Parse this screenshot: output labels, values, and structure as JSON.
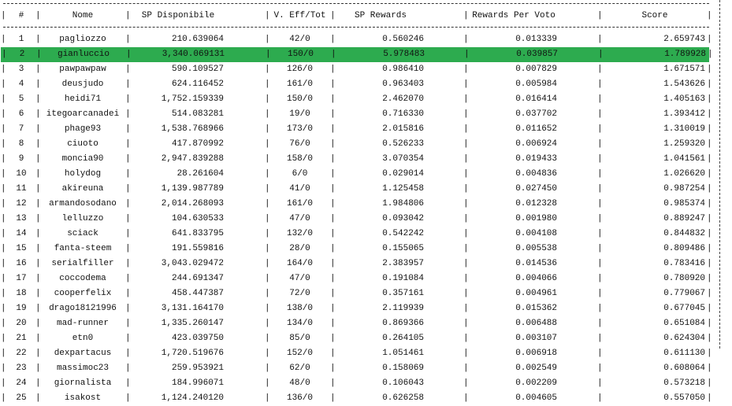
{
  "table": {
    "columns": [
      "#",
      "Nome",
      "SP Disponibile",
      "V. Eff/Tot",
      "SP Rewards",
      "Rewards Per Voto",
      "Score"
    ],
    "separator": "|",
    "highlight_color": "#2dab4f",
    "highlighted_rank": "2",
    "rows": [
      [
        "1",
        "pagliozzo",
        "210.639064",
        "42/0",
        "0.560246",
        "0.013339",
        "2.659743"
      ],
      [
        "2",
        "gianluccio",
        "3,340.069131",
        "150/0",
        "5.978483",
        "0.039857",
        "1.789928"
      ],
      [
        "3",
        "pawpawpaw",
        "590.109527",
        "126/0",
        "0.986410",
        "0.007829",
        "1.671571"
      ],
      [
        "4",
        "deusjudo",
        "624.116452",
        "161/0",
        "0.963403",
        "0.005984",
        "1.543626"
      ],
      [
        "5",
        "heidi71",
        "1,752.159339",
        "150/0",
        "2.462070",
        "0.016414",
        "1.405163"
      ],
      [
        "6",
        "itegoarcanadei",
        "514.083281",
        "19/0",
        "0.716330",
        "0.037702",
        "1.393412"
      ],
      [
        "7",
        "phage93",
        "1,538.768966",
        "173/0",
        "2.015816",
        "0.011652",
        "1.310019"
      ],
      [
        "8",
        "ciuoto",
        "417.870992",
        "76/0",
        "0.526233",
        "0.006924",
        "1.259320"
      ],
      [
        "9",
        "moncia90",
        "2,947.839288",
        "158/0",
        "3.070354",
        "0.019433",
        "1.041561"
      ],
      [
        "10",
        "holydog",
        "28.261604",
        "6/0",
        "0.029014",
        "0.004836",
        "1.026620"
      ],
      [
        "11",
        "akireuna",
        "1,139.987789",
        "41/0",
        "1.125458",
        "0.027450",
        "0.987254"
      ],
      [
        "12",
        "armandosodano",
        "2,014.268093",
        "161/0",
        "1.984806",
        "0.012328",
        "0.985374"
      ],
      [
        "13",
        "lelluzzo",
        "104.630533",
        "47/0",
        "0.093042",
        "0.001980",
        "0.889247"
      ],
      [
        "14",
        "sciack",
        "641.833795",
        "132/0",
        "0.542242",
        "0.004108",
        "0.844832"
      ],
      [
        "15",
        "fanta-steem",
        "191.559816",
        "28/0",
        "0.155065",
        "0.005538",
        "0.809486"
      ],
      [
        "16",
        "serialfiller",
        "3,043.029472",
        "164/0",
        "2.383957",
        "0.014536",
        "0.783416"
      ],
      [
        "17",
        "coccodema",
        "244.691347",
        "47/0",
        "0.191084",
        "0.004066",
        "0.780920"
      ],
      [
        "18",
        "cooperfelix",
        "458.447387",
        "72/0",
        "0.357161",
        "0.004961",
        "0.779067"
      ],
      [
        "19",
        "drago18121996",
        "3,131.164170",
        "138/0",
        "2.119939",
        "0.015362",
        "0.677045"
      ],
      [
        "20",
        "mad-runner",
        "1,335.260147",
        "134/0",
        "0.869366",
        "0.006488",
        "0.651084"
      ],
      [
        "21",
        "etn0",
        "423.039750",
        "85/0",
        "0.264105",
        "0.003107",
        "0.624304"
      ],
      [
        "22",
        "dexpartacus",
        "1,720.519676",
        "152/0",
        "1.051461",
        "0.006918",
        "0.611130"
      ],
      [
        "23",
        "massimoc23",
        "259.953921",
        "62/0",
        "0.158069",
        "0.002549",
        "0.608064"
      ],
      [
        "24",
        "giornalista",
        "184.996071",
        "48/0",
        "0.106043",
        "0.002209",
        "0.573218"
      ],
      [
        "25",
        "isakost",
        "1,124.240120",
        "136/0",
        "0.626258",
        "0.004605",
        "0.557050"
      ]
    ]
  }
}
